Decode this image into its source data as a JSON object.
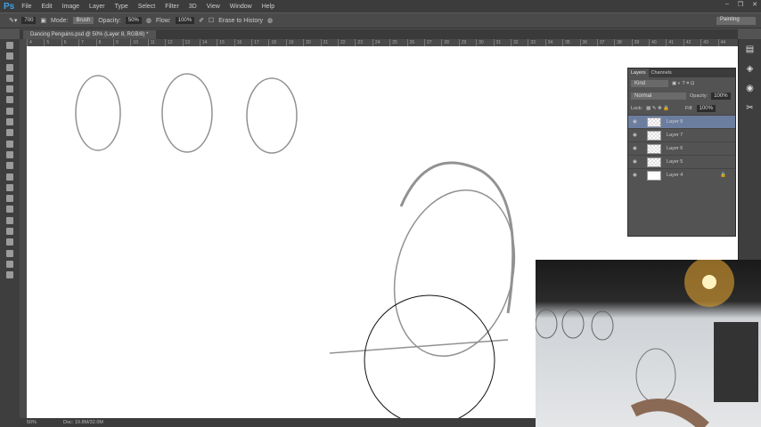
{
  "app": {
    "logo": "Ps"
  },
  "menu": [
    "File",
    "Edit",
    "Image",
    "Layer",
    "Type",
    "Select",
    "Filter",
    "3D",
    "View",
    "Window",
    "Help"
  ],
  "window_controls": [
    "–",
    "❐",
    "✕"
  ],
  "options": {
    "brush_size": "700",
    "mode_label": "Mode:",
    "mode": "Brush",
    "opacity_label": "Opacity:",
    "opacity": "50%",
    "flow_label": "Flow:",
    "flow": "100%",
    "erase_history": "Erase to History",
    "workspace": "Painting"
  },
  "document_tab": "Dancing Penguins.psd @ 50% (Layer 8, RGB/8) *",
  "ruler": [
    "4",
    "5",
    "6",
    "7",
    "8",
    "9",
    "10",
    "11",
    "12",
    "13",
    "14",
    "15",
    "16",
    "17",
    "18",
    "19",
    "20",
    "21",
    "22",
    "23",
    "24",
    "25",
    "26",
    "27",
    "28",
    "29",
    "30",
    "31",
    "32",
    "33",
    "34",
    "35",
    "36",
    "37",
    "38",
    "39",
    "40",
    "41",
    "42",
    "43",
    "44"
  ],
  "status": {
    "zoom": "50%",
    "doc": "Doc: 19.8M/32.0M"
  },
  "layers_panel": {
    "tabs": [
      "Layers",
      "Channels"
    ],
    "filter": "Kind",
    "blend": "Normal",
    "opacity_label": "Opacity:",
    "opacity": "100%",
    "lock_label": "Lock:",
    "fill_label": "Fill:",
    "fill": "100%",
    "layers": [
      {
        "name": "Layer 8",
        "selected": true
      },
      {
        "name": "Layer 7"
      },
      {
        "name": "Layer 6"
      },
      {
        "name": "Layer 5"
      },
      {
        "name": "Layer 4",
        "locked": true
      }
    ]
  }
}
